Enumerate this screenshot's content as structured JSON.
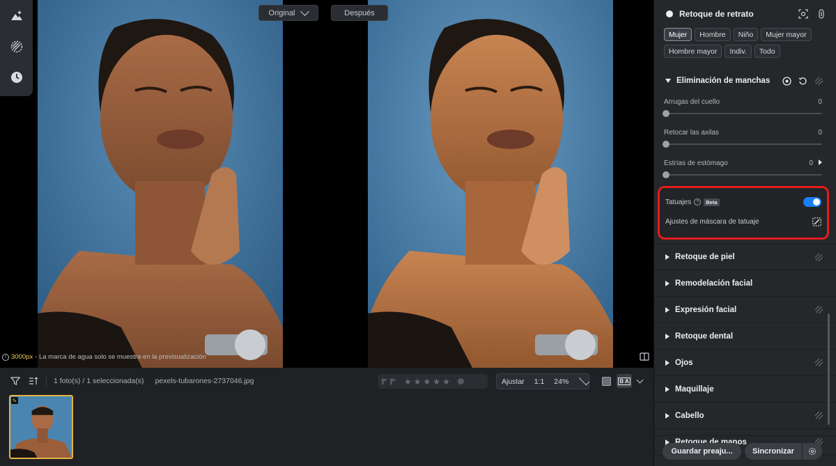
{
  "toolstrip": {
    "icons": [
      "adjust-icon",
      "mask-icon",
      "history-icon"
    ]
  },
  "compare": {
    "original_label": "Original",
    "after_label": "Después"
  },
  "watermark": {
    "resolution": "3000px",
    "text": " - La marca de agua solo se muestra en la previsualización"
  },
  "filmstrip": {
    "count_text": "1 foto(s) / 1 seleccionada(s)",
    "filename": "pexels-tubarones-2737046.jpg",
    "fit_label": "Ajustar",
    "ratio_label": "1:1",
    "zoom_label": "24%",
    "view_label": "B A",
    "rating": 0
  },
  "panel": {
    "title": "Retoque de retrato",
    "chips": [
      "Mujer",
      "Hombre",
      "Niño",
      "Mujer mayor",
      "Hombre mayor",
      "Indiv.",
      "Todo"
    ],
    "active_chip": "Mujer",
    "open_section": {
      "label": "Eliminación de manchas",
      "sliders": [
        {
          "label": "Arrugas del cuello",
          "value": "0"
        },
        {
          "label": "Retocar las axilas",
          "value": "0"
        },
        {
          "label": "Estrías de estómago",
          "value": "0"
        }
      ]
    },
    "tattoo": {
      "label": "Tatuajes",
      "beta": "Beta",
      "enabled": true,
      "mask_label": "Ajustes de máscara de tatuaje"
    },
    "sections": [
      {
        "label": "Retoque de piel"
      },
      {
        "label": "Remodelación facial"
      },
      {
        "label": "Expresión facial"
      },
      {
        "label": "Retoque dental"
      },
      {
        "label": "Ojos"
      },
      {
        "label": "Maquillaje"
      },
      {
        "label": "Cabello"
      },
      {
        "label": "Retoque de manos"
      }
    ],
    "footer": {
      "save_label": "Guardar preaju...",
      "sync_label": "Sincronizar"
    }
  },
  "colors": {
    "accent": "#1a7ef5",
    "highlight": "#e51c1c",
    "selection": "#e3b544",
    "backdrop_blue": "#3f7aa8"
  }
}
